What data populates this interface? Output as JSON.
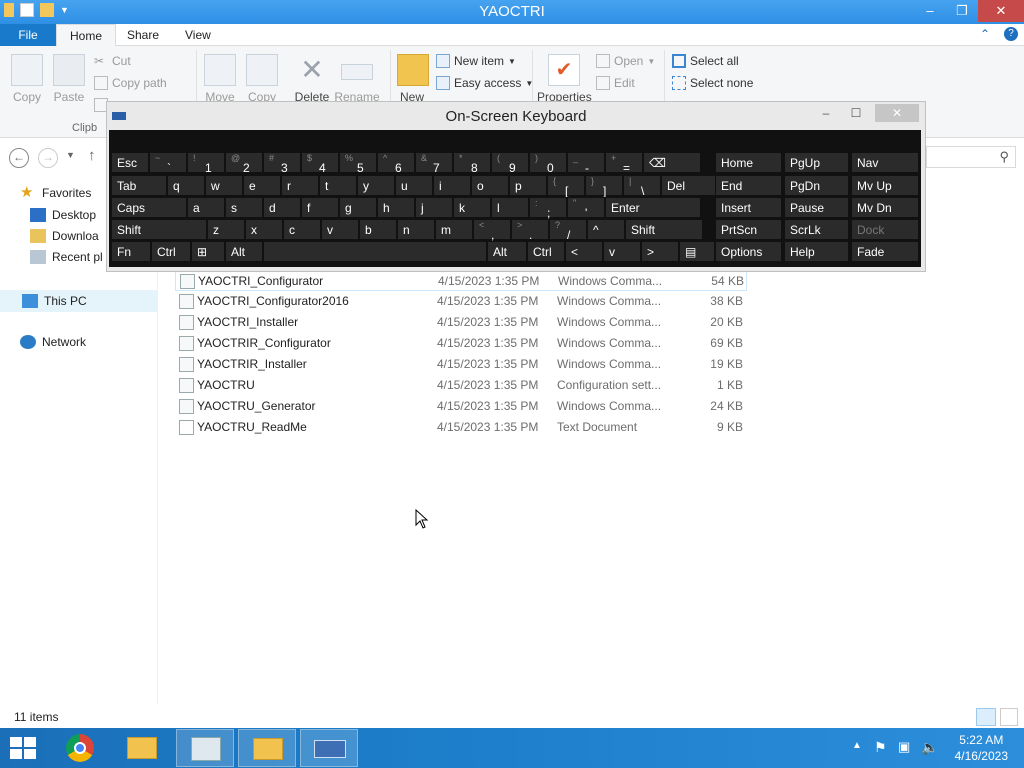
{
  "window": {
    "title": "YAOCTRI"
  },
  "tabs": {
    "file": "File",
    "home": "Home",
    "share": "Share",
    "view": "View"
  },
  "ribbon": {
    "copy": "Copy",
    "paste": "Paste",
    "cut": "Cut",
    "copy_path": "Copy path",
    "clipboard_group": "Clipb",
    "move": "Move",
    "copy_to": "Copy",
    "delete": "Delete",
    "rename": "Rename",
    "new": "New",
    "new_item": "New item",
    "easy_access": "Easy access",
    "properties": "Properties",
    "open": "Open",
    "edit": "Edit",
    "select_all": "Select all",
    "select_none": "Select none"
  },
  "nav": {
    "favorites": "Favorites",
    "desktop": "Desktop",
    "downloads": "Downloa",
    "recent": "Recent pl",
    "this_pc": "This PC",
    "network": "Network"
  },
  "files": [
    {
      "name": "YAOCTRI_Configurator",
      "date": "4/15/2023 1:35 PM",
      "type": "Windows Comma...",
      "size": "54 KB"
    },
    {
      "name": "YAOCTRI_Configurator2016",
      "date": "4/15/2023 1:35 PM",
      "type": "Windows Comma...",
      "size": "38 KB"
    },
    {
      "name": "YAOCTRI_Installer",
      "date": "4/15/2023 1:35 PM",
      "type": "Windows Comma...",
      "size": "20 KB"
    },
    {
      "name": "YAOCTRIR_Configurator",
      "date": "4/15/2023 1:35 PM",
      "type": "Windows Comma...",
      "size": "69 KB"
    },
    {
      "name": "YAOCTRIR_Installer",
      "date": "4/15/2023 1:35 PM",
      "type": "Windows Comma...",
      "size": "19 KB"
    },
    {
      "name": "YAOCTRU",
      "date": "4/15/2023 1:35 PM",
      "type": "Configuration sett...",
      "size": "1 KB"
    },
    {
      "name": "YAOCTRU_Generator",
      "date": "4/15/2023 1:35 PM",
      "type": "Windows Comma...",
      "size": "24 KB"
    },
    {
      "name": "YAOCTRU_ReadMe",
      "date": "4/15/2023 1:35 PM",
      "type": "Text Document",
      "size": "9 KB"
    }
  ],
  "status": {
    "count": "11 items"
  },
  "osk": {
    "title": "On-Screen Keyboard",
    "row1": [
      {
        "l": "Esc"
      },
      {
        "t": "~",
        "b": "`"
      },
      {
        "t": "!",
        "b": "1"
      },
      {
        "t": "@",
        "b": "2"
      },
      {
        "t": "#",
        "b": "3"
      },
      {
        "t": "$",
        "b": "4"
      },
      {
        "t": "%",
        "b": "5"
      },
      {
        "t": "^",
        "b": "6"
      },
      {
        "t": "&",
        "b": "7"
      },
      {
        "t": "*",
        "b": "8"
      },
      {
        "t": "(",
        "b": "9"
      },
      {
        "t": ")",
        "b": "0"
      },
      {
        "t": "_",
        "b": "-"
      },
      {
        "t": "+",
        "b": "="
      },
      {
        "l": "⌫"
      }
    ],
    "row2": [
      {
        "l": "Tab"
      },
      {
        "l": "q"
      },
      {
        "l": "w"
      },
      {
        "l": "e"
      },
      {
        "l": "r"
      },
      {
        "l": "t"
      },
      {
        "l": "y"
      },
      {
        "l": "u"
      },
      {
        "l": "i"
      },
      {
        "l": "o"
      },
      {
        "l": "p"
      },
      {
        "t": "{",
        "b": "["
      },
      {
        "t": "}",
        "b": "]"
      },
      {
        "t": "|",
        "b": "\\"
      },
      {
        "l": "Del"
      }
    ],
    "row3": [
      {
        "l": "Caps"
      },
      {
        "l": "a"
      },
      {
        "l": "s"
      },
      {
        "l": "d"
      },
      {
        "l": "f"
      },
      {
        "l": "g"
      },
      {
        "l": "h"
      },
      {
        "l": "j"
      },
      {
        "l": "k"
      },
      {
        "l": "l"
      },
      {
        "t": ":",
        "b": ";"
      },
      {
        "t": "\"",
        "b": "'"
      },
      {
        "l": "Enter"
      }
    ],
    "row4": [
      {
        "l": "Shift"
      },
      {
        "l": "z"
      },
      {
        "l": "x"
      },
      {
        "l": "c"
      },
      {
        "l": "v"
      },
      {
        "l": "b"
      },
      {
        "l": "n"
      },
      {
        "l": "m"
      },
      {
        "t": "<",
        "b": ","
      },
      {
        "t": ">",
        "b": "."
      },
      {
        "t": "?",
        "b": "/"
      },
      {
        "l": "^"
      },
      {
        "l": "Shift"
      }
    ],
    "row5": [
      {
        "l": "Fn"
      },
      {
        "l": "Ctrl"
      },
      {
        "l": "⊞"
      },
      {
        "l": "Alt"
      },
      {
        "l": ""
      },
      {
        "l": "Alt"
      },
      {
        "l": "Ctrl"
      },
      {
        "l": "<"
      },
      {
        "l": "v"
      },
      {
        "l": ">"
      },
      {
        "l": "▤"
      }
    ],
    "nav_keys": [
      [
        "Home",
        "PgUp",
        "Nav"
      ],
      [
        "End",
        "PgDn",
        "Mv Up"
      ],
      [
        "Insert",
        "Pause",
        "Mv Dn"
      ],
      [
        "PrtScn",
        "ScrLk",
        "Dock"
      ],
      [
        "Options",
        "Help",
        "Fade"
      ]
    ]
  },
  "taskbar": {
    "time": "5:22 AM",
    "date": "4/16/2023"
  }
}
